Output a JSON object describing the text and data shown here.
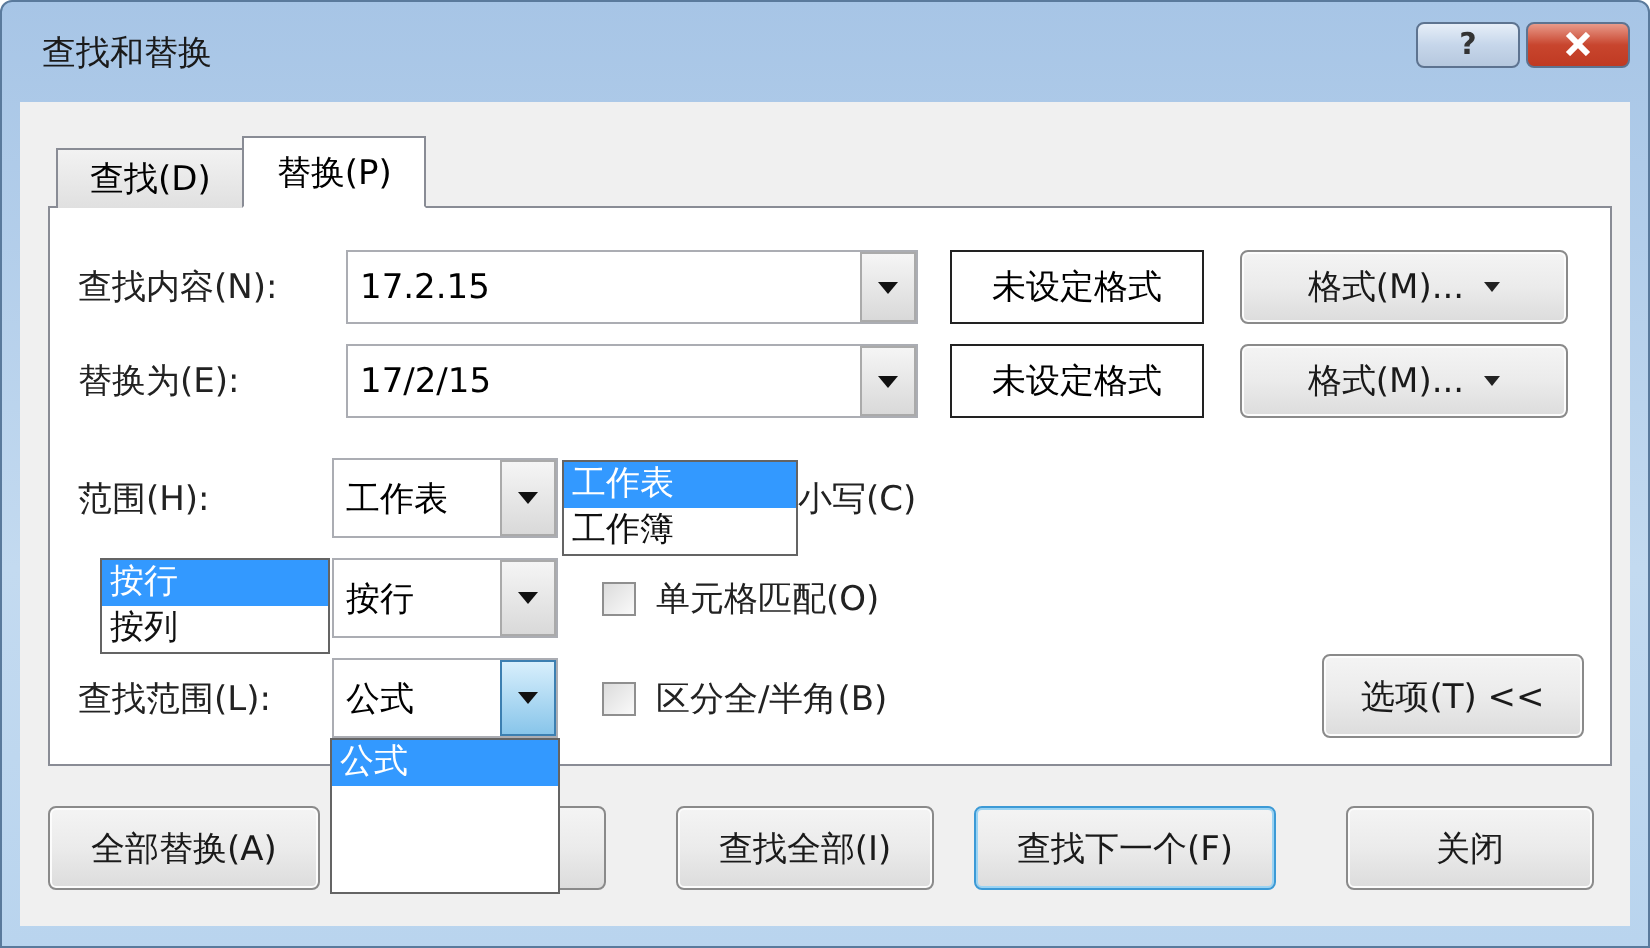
{
  "window": {
    "title": "查找和替换",
    "help_button": "?"
  },
  "tabs": [
    {
      "label": "查找(D)",
      "selected": false
    },
    {
      "label": "替换(P)",
      "selected": true
    }
  ],
  "fields": [
    {
      "label": "查找内容(N):",
      "value": "17.2.15",
      "format_status": "未设定格式",
      "format_button": "格式(M)..."
    },
    {
      "label": "替换为(E):",
      "value": "17/2/15",
      "format_status": "未设定格式",
      "format_button": "格式(M)..."
    }
  ],
  "combos": [
    {
      "label": "范围(H):",
      "value": "工作表",
      "active": false,
      "kind": "right",
      "popup": [
        {
          "label": "工作表",
          "selected": true
        },
        {
          "label": "工作簿",
          "selected": false
        }
      ]
    },
    {
      "value": "按行",
      "active": false,
      "kind": "left",
      "popup": [
        {
          "label": "按行",
          "selected": true
        },
        {
          "label": "按列",
          "selected": false
        }
      ]
    },
    {
      "label": "查找范围(L):",
      "value": "公式",
      "active": true,
      "kind": "below",
      "popup": [
        {
          "label": "公式",
          "selected": true
        }
      ]
    }
  ],
  "checkboxes": [
    {
      "kind": "covered",
      "label": "小写(C)"
    },
    {
      "kind": "checkbox",
      "label": "单元格匹配(O)",
      "checked": false
    },
    {
      "kind": "checkbox",
      "label": "区分全/半角(B)",
      "checked": false
    }
  ],
  "options_button": "选项(T) <<",
  "buttons": [
    {
      "kind": "button",
      "label": "全部替换(A)",
      "default": false
    },
    {
      "kind": "covered"
    },
    {
      "kind": "button",
      "label": "查找全部(I)",
      "default": false
    },
    {
      "kind": "button",
      "label": "查找下一个(F)",
      "default": true
    },
    {
      "kind": "button",
      "label": "关闭",
      "default": false
    }
  ]
}
